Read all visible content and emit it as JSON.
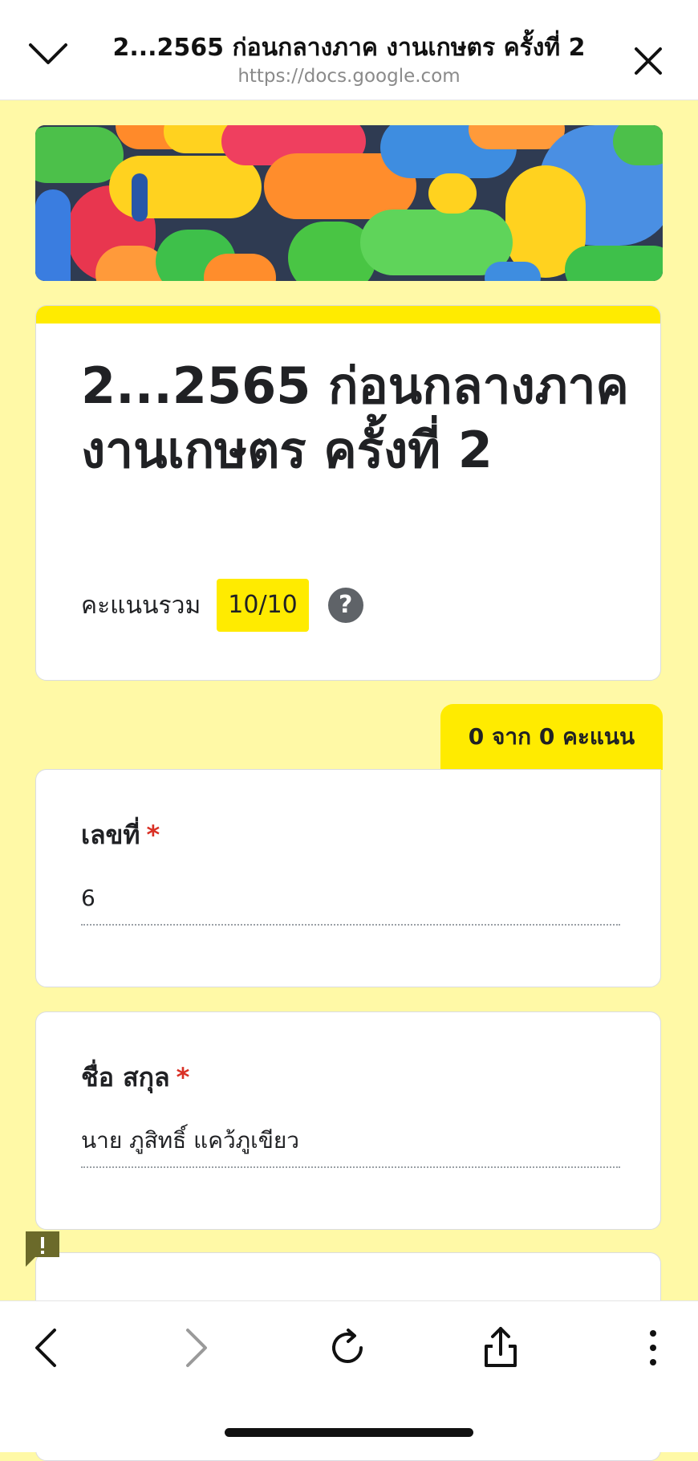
{
  "browser": {
    "title": "2...2565 ก่อนกลางภาค งานเกษตร ครั้งที่ 2",
    "url": "https://docs.google.com",
    "icons": [
      "chevron-down-icon",
      "close-icon",
      "back-icon",
      "forward-icon",
      "reload-icon",
      "share-icon",
      "more-icon"
    ]
  },
  "form": {
    "title": "2...2565 ก่อนกลางภาค งานเกษตร ครั้งที่ 2",
    "score_label": "คะแนนรวม",
    "score_value": "10/10",
    "help_glyph": "?",
    "points_tab": "0 จาก 0 คะแนน"
  },
  "questions": [
    {
      "label": "เลขที่",
      "required": "*",
      "answer": "6"
    },
    {
      "label": "ชื่อ  สกุล",
      "required": "*",
      "answer": "นาย ภูสิทธิ์ แคว้ภูเขียว"
    }
  ],
  "colors": {
    "background": "#fff9a6",
    "accent": "#ffeb00",
    "required": "#d93025"
  }
}
